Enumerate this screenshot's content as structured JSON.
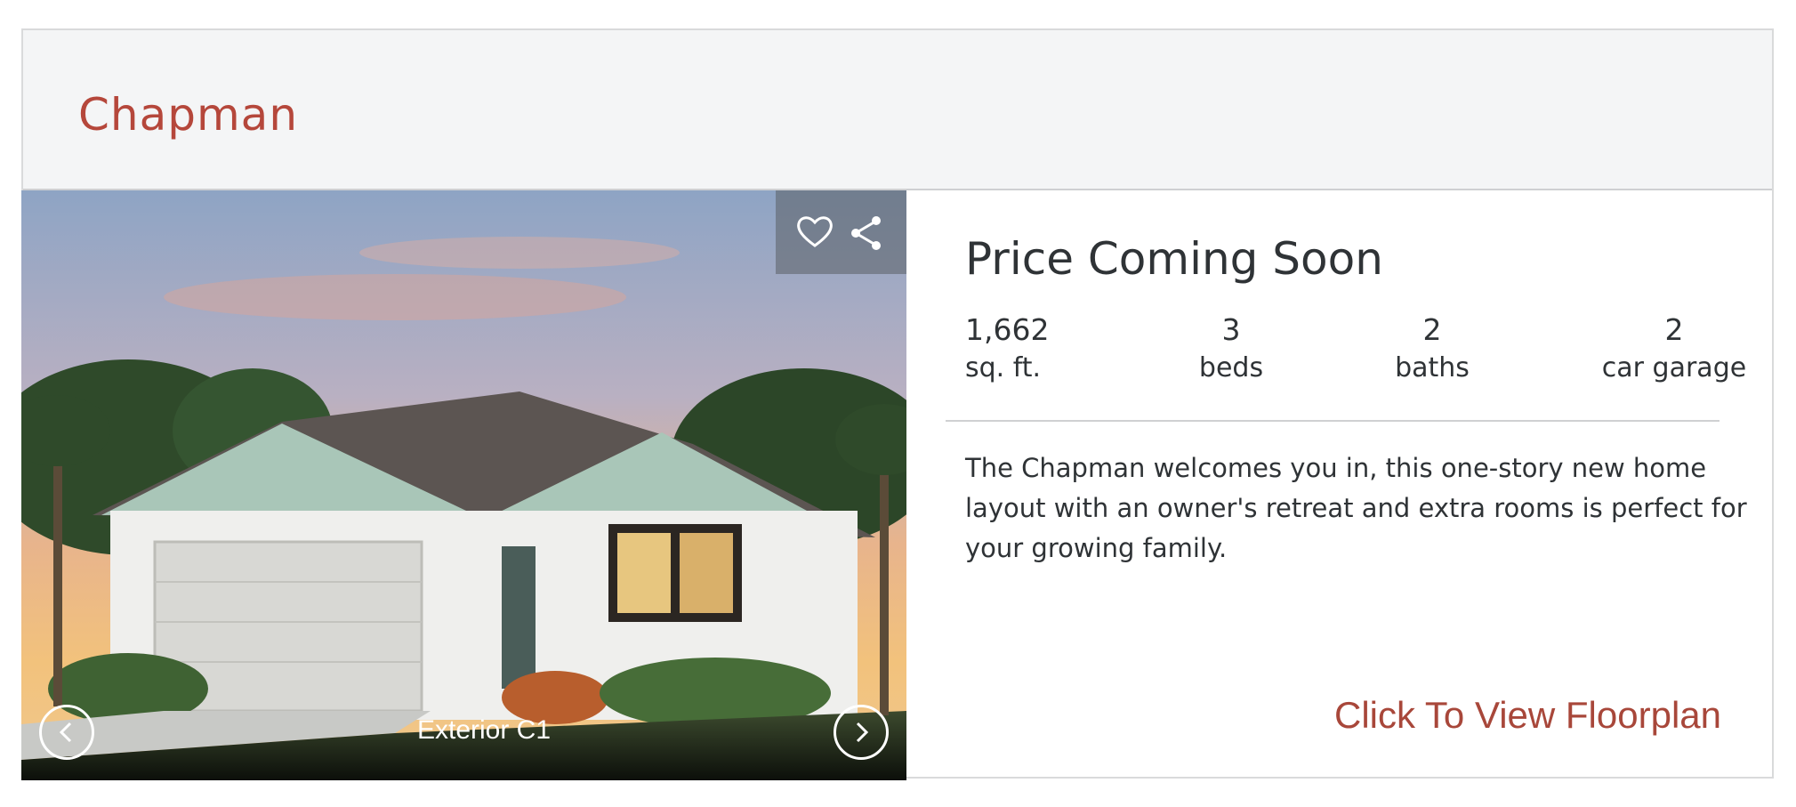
{
  "plan": {
    "name": "Chapman"
  },
  "gallery": {
    "caption": "Exterior C1",
    "icons": {
      "favorite": "heart-icon",
      "share": "share-icon",
      "prev": "chevron-left-icon",
      "next": "chevron-right-icon"
    }
  },
  "details": {
    "price": "Price Coming Soon",
    "stats": [
      {
        "value": "1,662",
        "label": "sq. ft."
      },
      {
        "value": "3",
        "label": "beds"
      },
      {
        "value": "2",
        "label": "baths"
      },
      {
        "value": "2",
        "label": "car garage"
      }
    ],
    "description": "The Chapman welcomes you in, this one-story new home layout with an owner's retreat and extra rooms is perfect for your growing family.",
    "cta": "Click To View Floorplan"
  },
  "colors": {
    "accent": "#b5473b",
    "header_bg": "#f4f5f6",
    "text": "#2f3336"
  }
}
